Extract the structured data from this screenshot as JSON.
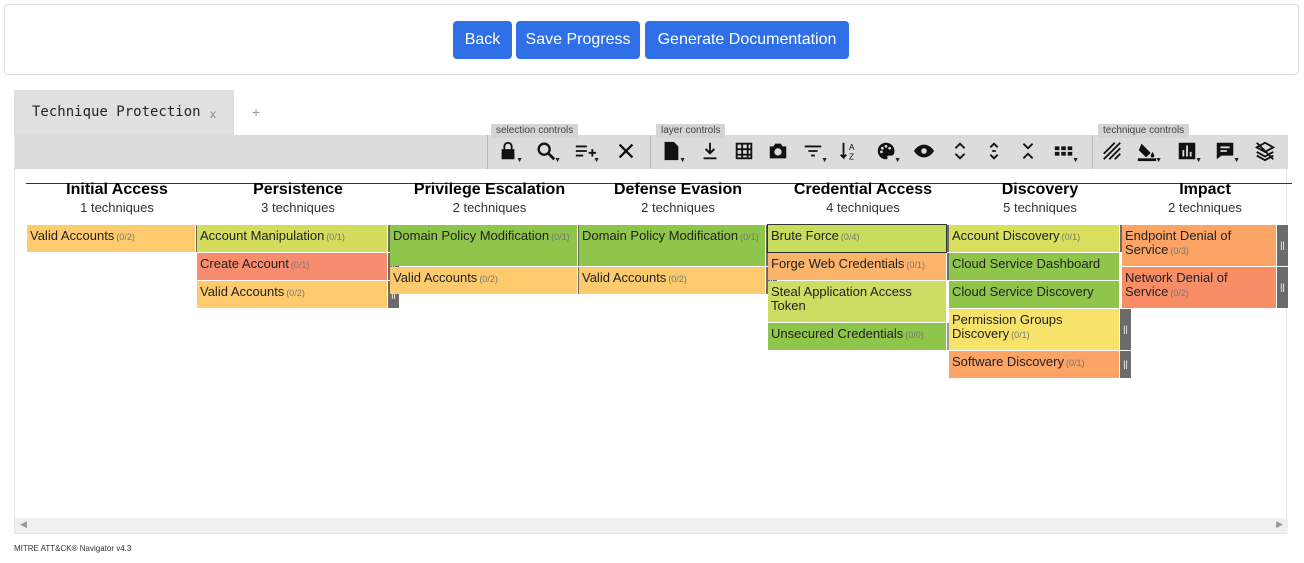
{
  "buttons": {
    "back": "Back",
    "save": "Save Progress",
    "generate": "Generate Documentation"
  },
  "tab": {
    "title": "Technique Protection",
    "close": "x",
    "add": "+"
  },
  "toolbar_labels": {
    "selection": "selection controls",
    "layer": "layer controls",
    "technique": "technique controls"
  },
  "tactics": [
    {
      "name": "Initial Access",
      "count": "1 techniques"
    },
    {
      "name": "Persistence",
      "count": "3 techniques"
    },
    {
      "name": "Privilege Escalation",
      "count": "2 techniques"
    },
    {
      "name": "Defense Evasion",
      "count": "2 techniques"
    },
    {
      "name": "Credential Access",
      "count": "4 techniques"
    },
    {
      "name": "Discovery",
      "count": "5 techniques"
    },
    {
      "name": "Impact",
      "count": "2 techniques"
    }
  ],
  "techniques": [
    [
      {
        "name": "Valid Accounts",
        "score": "(0/2)",
        "color": "#fdcb6e"
      }
    ],
    [
      {
        "name": "Account Manipulation",
        "score": "(0/1)",
        "color": "#d4dc5e"
      },
      {
        "name": "Create Account",
        "score": "(0/1)",
        "color": "#f78d6e"
      },
      {
        "name": "Valid Accounts",
        "score": "(0/2)",
        "color": "#fdcb6e"
      }
    ],
    [
      {
        "name": "Domain Policy Modification",
        "score": "(0/1)",
        "color": "#8ec54a"
      },
      {
        "name": "Valid Accounts",
        "score": "(0/2)",
        "color": "#fdcb6e"
      }
    ],
    [
      {
        "name": "Domain Policy Modification",
        "score": "(0/1)",
        "color": "#8ec54a"
      },
      {
        "name": "Valid Accounts",
        "score": "(0/2)",
        "color": "#fdcb6e"
      }
    ],
    [
      {
        "name": "Brute Force",
        "score": "(0/4)",
        "color": "#c8dc5e"
      },
      {
        "name": "Forge Web Credentials",
        "score": "(0/1)",
        "color": "#fcb36a"
      },
      {
        "name": "Steal Application Access Token",
        "score": "",
        "color": "#cddc62"
      },
      {
        "name": "Unsecured Credentials",
        "score": "(0/0)",
        "color": "#8ec54a"
      }
    ],
    [
      {
        "name": "Account Discovery",
        "score": "(0/1)",
        "color": "#d8df5e"
      },
      {
        "name": "Cloud Service Dashboard",
        "score": "",
        "color": "#8ec54a"
      },
      {
        "name": "Cloud Service Discovery",
        "score": "",
        "color": "#8ec54a"
      },
      {
        "name": "Permission Groups Discovery",
        "score": "(0/1)",
        "color": "#f7e26b"
      },
      {
        "name": "Software Discovery",
        "score": "(0/1)",
        "color": "#fba466"
      }
    ],
    [
      {
        "name": "Endpoint Denial of Service",
        "score": "(0/3)",
        "color": "#fba466"
      },
      {
        "name": "Network Denial of Service",
        "score": "(0/2)",
        "color": "#f98e66"
      }
    ]
  ],
  "footer": "MITRE ATT&CK® Navigator v4.3"
}
